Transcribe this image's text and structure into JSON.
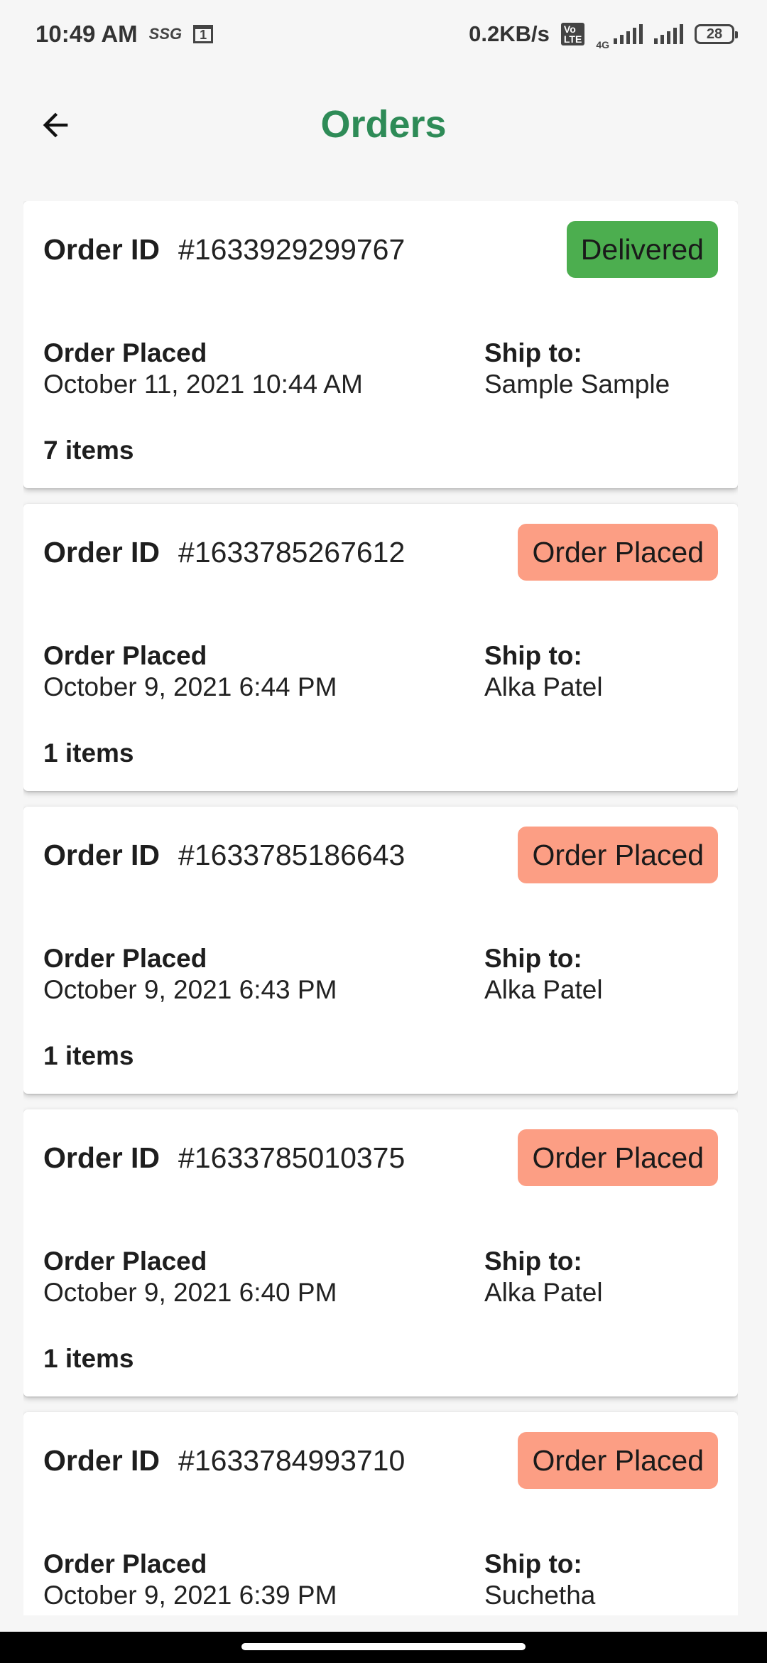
{
  "status_bar": {
    "time": "10:49 AM",
    "carrier_icon_text": "SSG",
    "calendar_day": "1",
    "net_speed": "0.2KB/s",
    "volte": "Vo LTE",
    "network_type": "4G",
    "battery": "28"
  },
  "header": {
    "title": "Orders",
    "title_color": "#2e8b57",
    "back_icon": "arrow-left-icon"
  },
  "orders": [
    {
      "id_label": "Order ID",
      "id": "#1633929299767",
      "status": "Delivered",
      "placed_label": "Order Placed",
      "placed_at": "October 11, 2021 10:44 AM",
      "ship_label": "Ship to:",
      "ship_to": "Sample Sample",
      "items": "7 items"
    },
    {
      "id_label": "Order ID",
      "id": "#1633785267612",
      "status": "Order Placed",
      "placed_label": "Order Placed",
      "placed_at": "October 9, 2021 6:44 PM",
      "ship_label": "Ship to:",
      "ship_to": "Alka Patel",
      "items": "1 items"
    },
    {
      "id_label": "Order ID",
      "id": "#1633785186643",
      "status": "Order Placed",
      "placed_label": "Order Placed",
      "placed_at": "October 9, 2021 6:43 PM",
      "ship_label": "Ship to:",
      "ship_to": "Alka Patel",
      "items": "1 items"
    },
    {
      "id_label": "Order ID",
      "id": "#1633785010375",
      "status": "Order Placed",
      "placed_label": "Order Placed",
      "placed_at": "October 9, 2021 6:40 PM",
      "ship_label": "Ship to:",
      "ship_to": "Alka Patel",
      "items": "1 items"
    },
    {
      "id_label": "Order ID",
      "id": "#1633784993710",
      "status": "Order Placed",
      "placed_label": "Order Placed",
      "placed_at": "October 9, 2021 6:39 PM",
      "ship_label": "Ship to:",
      "ship_to": "Suchetha",
      "items": ""
    }
  ],
  "colors": {
    "delivered": "#4cae4f",
    "order_placed": "#fc9e84"
  }
}
